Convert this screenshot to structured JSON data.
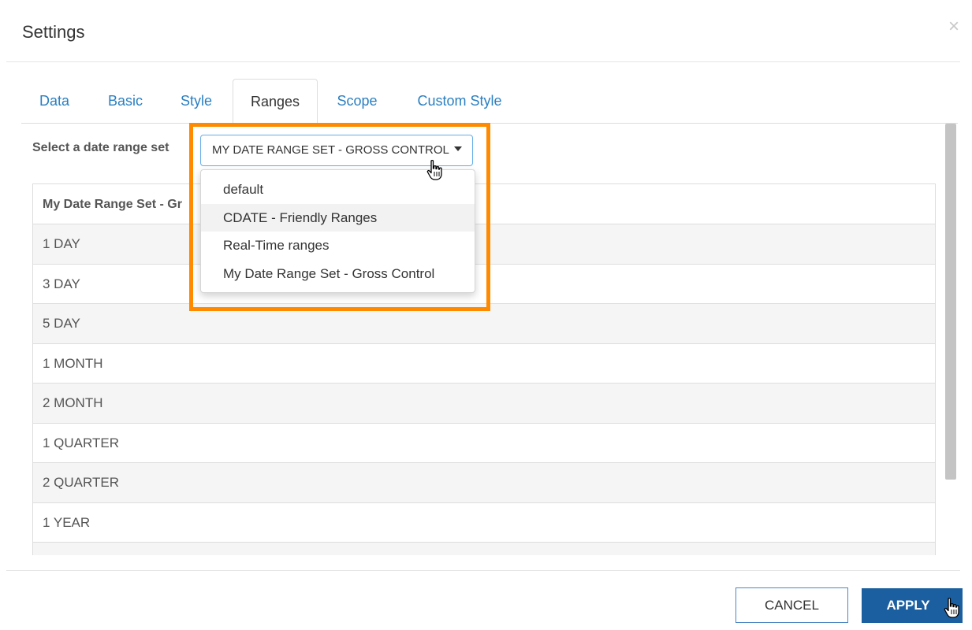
{
  "dialog": {
    "title": "Settings",
    "close_glyph": "×"
  },
  "tabs": [
    {
      "label": "Data",
      "active": false
    },
    {
      "label": "Basic",
      "active": false
    },
    {
      "label": "Style",
      "active": false
    },
    {
      "label": "Ranges",
      "active": true
    },
    {
      "label": "Scope",
      "active": false
    },
    {
      "label": "Custom Style",
      "active": false
    }
  ],
  "ranges": {
    "select_label": "Select a date range set",
    "selected_value": "MY DATE RANGE SET - GROSS CONTROL",
    "options": [
      "default",
      "CDATE - Friendly Ranges",
      "Real-Time ranges",
      "My Date Range Set - Gross Control"
    ],
    "hovered_option_index": 1,
    "table_header": "My Date Range Set - Gr",
    "rows": [
      "1 DAY",
      "3 DAY",
      "5 DAY",
      "1 MONTH",
      "2 MONTH",
      "1 QUARTER",
      "2 QUARTER",
      "1 YEAR",
      ""
    ]
  },
  "footer": {
    "cancel_label": "CANCEL",
    "apply_label": "APPLY"
  },
  "colors": {
    "tab_link": "#2a7fc1",
    "highlight_outline": "#ff8a00",
    "apply_button": "#1b5fa0",
    "cancel_border": "#4a86c5"
  },
  "icons": {
    "close": "close-icon",
    "caret": "caret-down-icon",
    "pointer": "hand-pointer-icon"
  }
}
